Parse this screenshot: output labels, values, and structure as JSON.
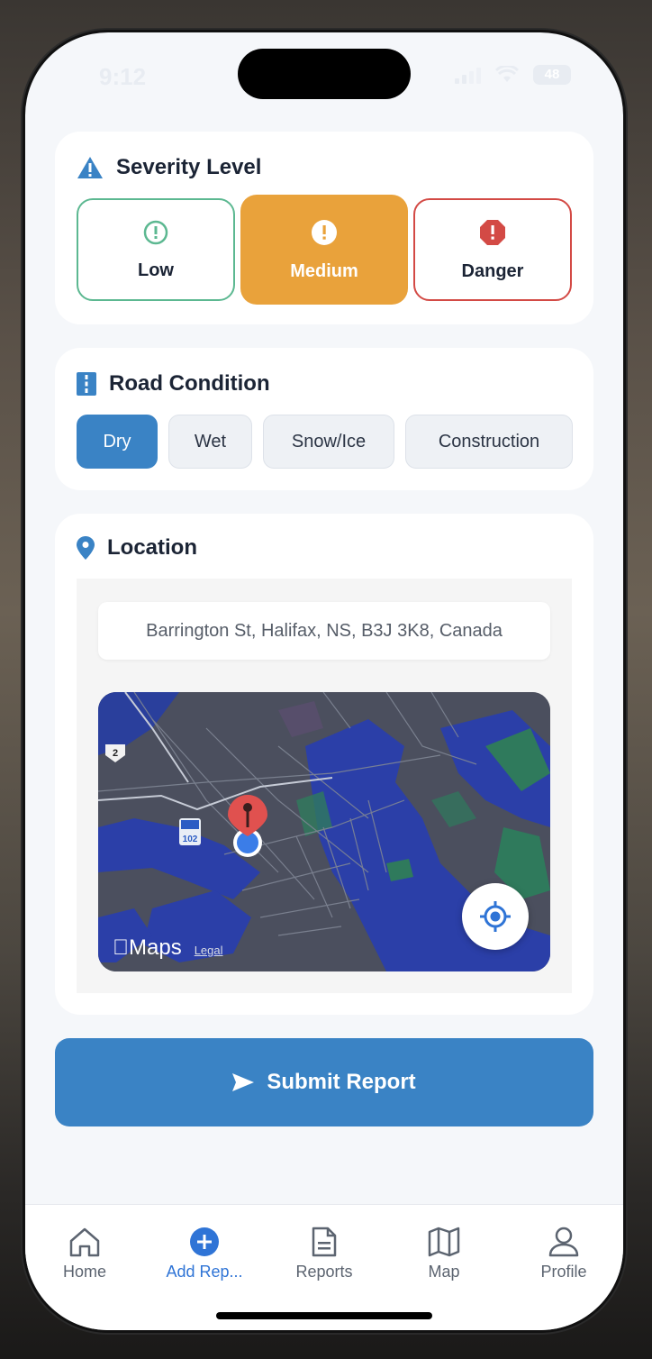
{
  "status_bar": {
    "time": "9:12",
    "battery": "48"
  },
  "severity": {
    "title": "Severity Level",
    "options": [
      {
        "label": "Low",
        "color": "#5cb891"
      },
      {
        "label": "Medium",
        "color": "#e9a23b",
        "selected": true
      },
      {
        "label": "Danger",
        "color": "#d34a45"
      }
    ]
  },
  "road_condition": {
    "title": "Road Condition",
    "options": [
      {
        "label": "Dry",
        "selected": true
      },
      {
        "label": "Wet"
      },
      {
        "label": "Snow/Ice"
      },
      {
        "label": "Construction"
      }
    ]
  },
  "location": {
    "title": "Location",
    "address": "Barrington St, Halifax, NS, B3J 3K8, Canada",
    "map": {
      "brand": "Maps",
      "legal": "Legal",
      "shield_highway": "2",
      "shield_route": "102"
    }
  },
  "submit_label": "Submit Report",
  "tabs": [
    {
      "label": "Home",
      "icon": "home-icon"
    },
    {
      "label": "Add Rep...",
      "icon": "add-circle-icon",
      "active": true
    },
    {
      "label": "Reports",
      "icon": "document-icon"
    },
    {
      "label": "Map",
      "icon": "map-icon"
    },
    {
      "label": "Profile",
      "icon": "person-icon"
    }
  ],
  "colors": {
    "primary": "#3a83c5",
    "tab_active": "#2f74d6",
    "medium": "#e9a23b",
    "danger": "#d34a45",
    "low": "#5cb891"
  }
}
